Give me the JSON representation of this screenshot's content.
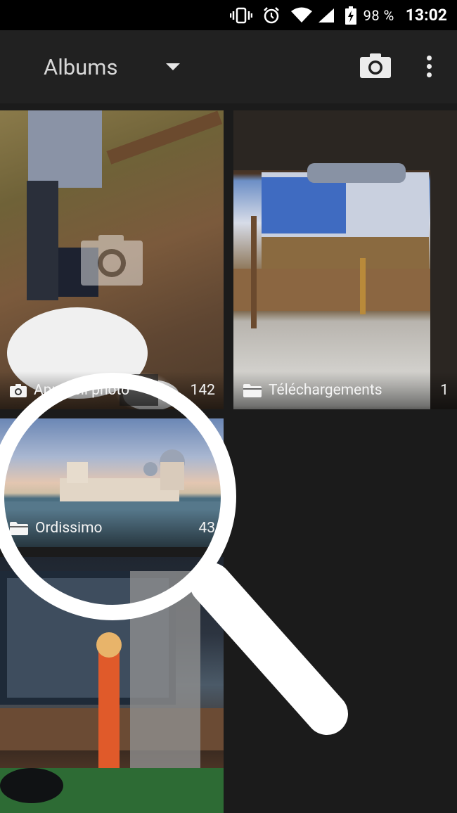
{
  "status_bar": {
    "battery_percent": "98 %",
    "time": "13:02",
    "icons": [
      "vibrate-icon",
      "alarm-icon",
      "wifi-icon",
      "cell-signal-icon",
      "battery-charging-icon"
    ]
  },
  "app_bar": {
    "title": "Albums",
    "dropdown_icon": "chevron-down-icon",
    "camera_icon": "camera-icon",
    "overflow_icon": "more-vert-icon"
  },
  "albums": [
    {
      "name": "Appareil photo",
      "count": "142",
      "icon": "camera-icon"
    },
    {
      "name": "Téléchargements",
      "count": "1",
      "icon": "folder-icon"
    },
    {
      "name": "Ordissimo",
      "count": "43",
      "icon": "folder-icon"
    }
  ],
  "colors": {
    "status_bar_bg": "#000000",
    "app_bar_bg": "#212121",
    "page_bg": "#1b1b1b",
    "text": "#ffffff"
  }
}
